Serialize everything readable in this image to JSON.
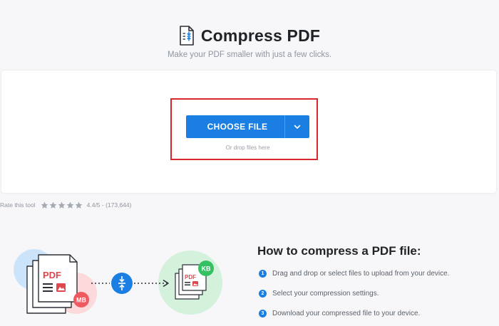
{
  "header": {
    "title": "Compress PDF",
    "subtitle": "Make your PDF smaller with just a few clicks.",
    "title_icon": "compress-document-icon"
  },
  "upload": {
    "button_label": "CHOOSE FILE",
    "button_icon": "chevron-down-icon",
    "drop_hint": "Or drop files here"
  },
  "rating": {
    "label": "Rate this tool",
    "stars": 5,
    "score_text": "4.4/5 - (173,644)"
  },
  "illustration": {
    "source_doc_label": "PDF",
    "source_badge": "MB",
    "target_doc_label": "PDF",
    "target_badge": "KB",
    "compress_icon": "compress-arrows-icon",
    "arrow_icon": "arrow-right-icon"
  },
  "howto": {
    "title": "How to compress a PDF file:",
    "steps": [
      {
        "num": "1",
        "text": "Drag and drop or select files to upload from your device."
      },
      {
        "num": "2",
        "text": "Select your compression settings."
      },
      {
        "num": "3",
        "text": "Download your compressed file to your device."
      }
    ]
  },
  "colors": {
    "accent": "#1a7ee3",
    "highlight": "#d9262c",
    "badge_red": "#ee5a60",
    "badge_green": "#35c063",
    "circle_blue": "#cce4fa",
    "circle_pink": "#fcd9da",
    "circle_green": "#d3f1db"
  }
}
